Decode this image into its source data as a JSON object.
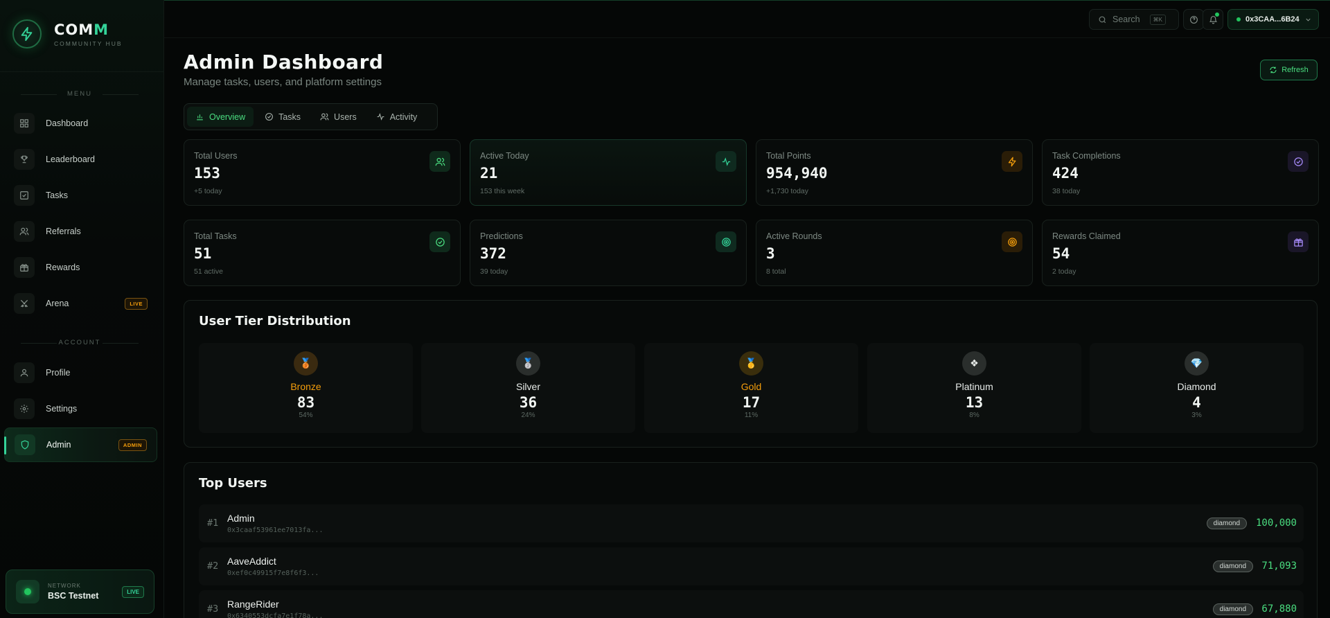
{
  "brand": {
    "name_main": "COM",
    "name_accent": "M",
    "subtitle": "COMMUNITY HUB"
  },
  "sidebar": {
    "menu_label": "MENU",
    "account_label": "ACCOUNT",
    "menu_items": [
      {
        "label": "Dashboard",
        "icon": "grid-icon"
      },
      {
        "label": "Leaderboard",
        "icon": "trophy-icon"
      },
      {
        "label": "Tasks",
        "icon": "checkbox-icon"
      },
      {
        "label": "Referrals",
        "icon": "users-icon"
      },
      {
        "label": "Rewards",
        "icon": "gift-icon"
      },
      {
        "label": "Arena",
        "icon": "swords-icon",
        "badge": "LIVE"
      }
    ],
    "account_items": [
      {
        "label": "Profile",
        "icon": "user-icon"
      },
      {
        "label": "Settings",
        "icon": "gear-icon"
      },
      {
        "label": "Admin",
        "icon": "shield-icon",
        "badge": "ADMIN",
        "active": true
      }
    ],
    "network": {
      "label": "NETWORK",
      "name": "BSC Testnet",
      "status": "LIVE"
    }
  },
  "topbar": {
    "search_placeholder": "Search",
    "search_shortcut": "⌘K",
    "wallet": "0x3CAA...6B24"
  },
  "page": {
    "title": "Admin Dashboard",
    "subtitle": "Manage tasks, users, and platform settings",
    "refresh_label": "Refresh",
    "tabs": [
      {
        "label": "Overview",
        "active": true
      },
      {
        "label": "Tasks"
      },
      {
        "label": "Users"
      },
      {
        "label": "Activity"
      }
    ]
  },
  "stats": [
    {
      "label": "Total Users",
      "value": "153",
      "sub": "+5 today",
      "icon": "users-icon",
      "color": "#4ade80"
    },
    {
      "label": "Active Today",
      "value": "21",
      "sub": "153 this week",
      "icon": "activity-icon",
      "color": "#34d399"
    },
    {
      "label": "Total Points",
      "value": "954,940",
      "sub": "+1,730 today",
      "icon": "lightning-icon",
      "color": "#f59e0b"
    },
    {
      "label": "Task Completions",
      "value": "424",
      "sub": "38 today",
      "icon": "check-circle-icon",
      "color": "#a78bfa"
    },
    {
      "label": "Total Tasks",
      "value": "51",
      "sub": "51 active",
      "icon": "check-circle-icon",
      "color": "#4ade80"
    },
    {
      "label": "Predictions",
      "value": "372",
      "sub": "39 today",
      "icon": "target-icon",
      "color": "#34d399"
    },
    {
      "label": "Active Rounds",
      "value": "3",
      "sub": "8 total",
      "icon": "target-icon",
      "color": "#f59e0b"
    },
    {
      "label": "Rewards Claimed",
      "value": "54",
      "sub": "2 today",
      "icon": "gift-icon",
      "color": "#a78bfa"
    }
  ],
  "tiers": {
    "title": "User Tier Distribution",
    "items": [
      {
        "name": "Bronze",
        "count": "83",
        "pct": "54%",
        "icon": "medal-bronze-icon",
        "color": "#f59e0b",
        "glyph": "🥉"
      },
      {
        "name": "Silver",
        "count": "36",
        "pct": "24%",
        "icon": "medal-silver-icon",
        "color": "#e8ece9",
        "glyph": "🥈"
      },
      {
        "name": "Gold",
        "count": "17",
        "pct": "11%",
        "icon": "medal-gold-icon",
        "color": "#f59e0b",
        "glyph": "🥇"
      },
      {
        "name": "Platinum",
        "count": "13",
        "pct": "8%",
        "icon": "diamond-shape-icon",
        "color": "#e8ece9",
        "glyph": "❖"
      },
      {
        "name": "Diamond",
        "count": "4",
        "pct": "3%",
        "icon": "gem-icon",
        "color": "#e8ece9",
        "glyph": "💎"
      }
    ]
  },
  "top_users": {
    "title": "Top Users",
    "rows": [
      {
        "rank": "#1",
        "name": "Admin",
        "address": "0x3caaf53961ee7013fa...",
        "tier": "diamond",
        "points": "100,000"
      },
      {
        "rank": "#2",
        "name": "AaveAddict",
        "address": "0xef0c49915f7e8f6f3...",
        "tier": "diamond",
        "points": "71,093"
      },
      {
        "rank": "#3",
        "name": "RangeRider",
        "address": "0x6340553dcfa7e1f78a...",
        "tier": "diamond",
        "points": "67,880"
      }
    ]
  }
}
